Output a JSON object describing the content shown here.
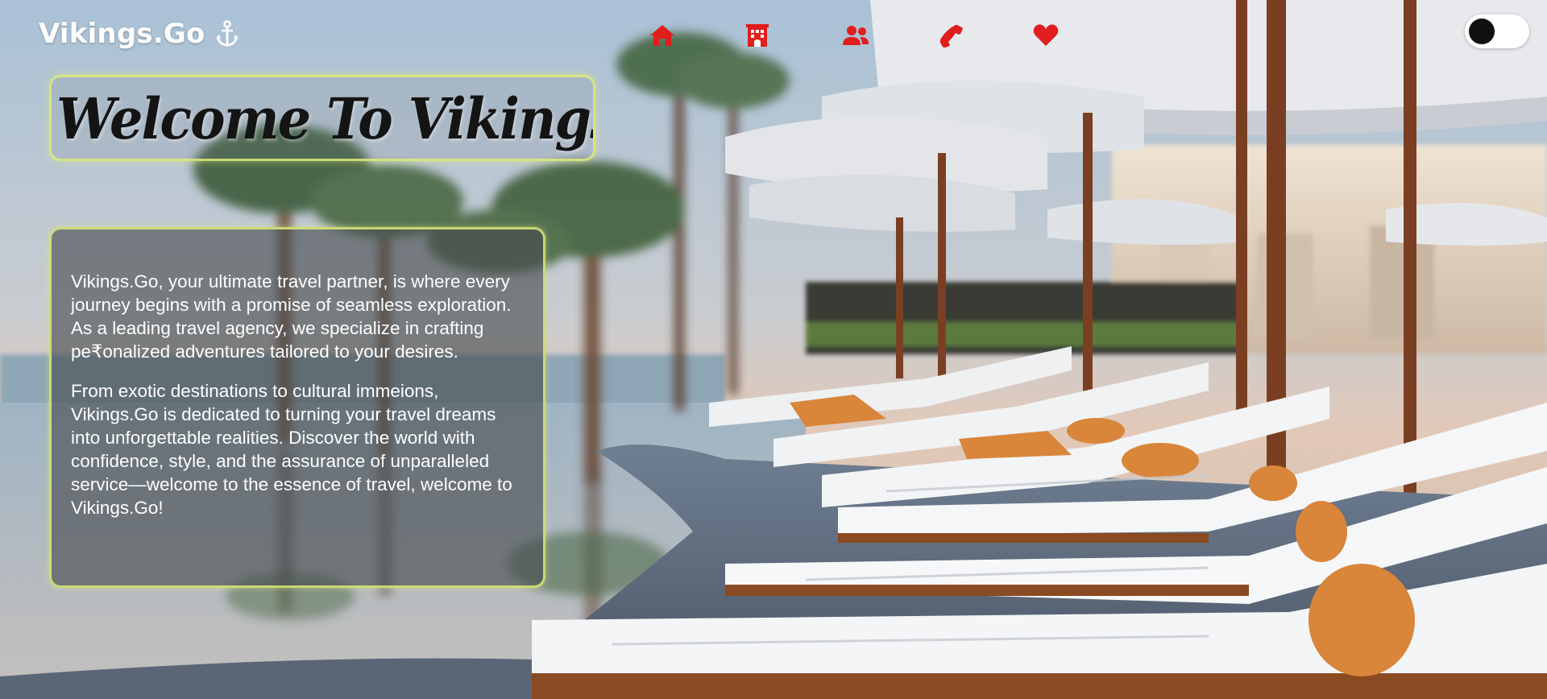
{
  "header": {
    "brand": "Vikings.Go",
    "brand_icon": "anchor-icon",
    "nav": [
      {
        "name": "home",
        "icon": "home-icon"
      },
      {
        "name": "hotels",
        "icon": "hotel-icon"
      },
      {
        "name": "team",
        "icon": "users-icon"
      },
      {
        "name": "contact",
        "icon": "phone-icon"
      },
      {
        "name": "favorites",
        "icon": "heart-icon"
      }
    ],
    "nav_icon_color": "#e11d1d",
    "theme_toggle": {
      "state": "off"
    }
  },
  "hero": {
    "welcome_title": "Welcome To Vikings.Go",
    "about_paragraphs": [
      "Vikings.Go, your ultimate travel partner, is where every journey begins with a promise of seamless exploration. As a leading travel agency, we specialize in crafting pe₹onalized adventures tailored to your desires.",
      "From exotic destinations to cultural immeions, Vikings.Go is dedicated to turning your travel dreams into unforgettable realities. Discover the world with confidence, style, and the assurance of unparalleled service—welcome to the essence of travel, welcome to Vikings.Go!"
    ]
  },
  "colors": {
    "panel_border": "#dcec78",
    "nav_icon": "#e11d1d"
  }
}
